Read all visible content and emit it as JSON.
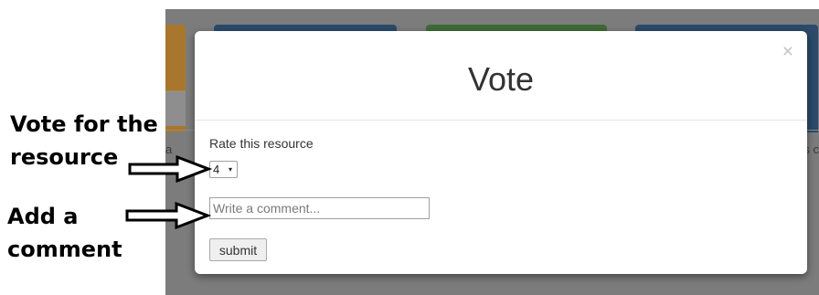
{
  "modal": {
    "title": "Vote",
    "close_symbol": "×",
    "rate_label": "Rate this resource",
    "rating_value": "4",
    "rating_caret": "▾",
    "comment_placeholder": "Write a comment...",
    "submit_label": "submit"
  },
  "annotations": {
    "vote_line1": "Vote for the",
    "vote_line2": "resource",
    "comment_line1": "Add a",
    "comment_line2": "comment"
  },
  "background": {
    "left_fragment": "a",
    "right_fragment": "s c"
  },
  "colors": {
    "overlay": "#7c7c7c",
    "tile_blue": "#2c4a6a",
    "tile_green": "#3f6a36",
    "tile_orange": "#a8772d"
  }
}
